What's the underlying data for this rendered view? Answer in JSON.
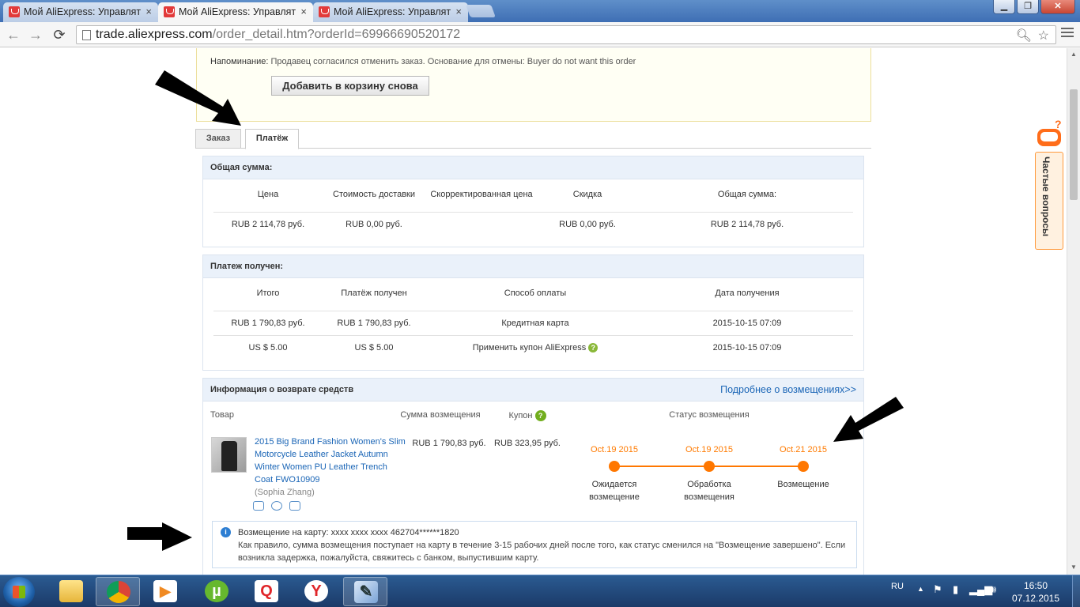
{
  "browser": {
    "tabs": [
      {
        "title": "Мой AliExpress: Управлят",
        "close": "×"
      },
      {
        "title": "Мой AliExpress: Управлят",
        "close": "×"
      },
      {
        "title": "Мой AliExpress: Управлят",
        "close": "×"
      }
    ],
    "window_buttons": {
      "minimize": "▁",
      "maximize": "❐",
      "close": "✕"
    },
    "address": {
      "host": "trade.aliexpress.com",
      "path": "/order_detail.htm?orderId=69966690520172"
    },
    "nav": {
      "back": "←",
      "forward": "→",
      "reload": "⟳"
    }
  },
  "notice": {
    "label": "Напоминание:",
    "text": "Продавец согласился отменить заказ. Основание для отмены: Buyer do not want this order",
    "button": "Добавить в корзину снова"
  },
  "tabs": [
    {
      "label": "Заказ"
    },
    {
      "label": "Платёж"
    }
  ],
  "total_panel": {
    "title": "Общая сумма:",
    "headers": [
      "Цена",
      "Стоимость доставки",
      "Скорректированная цена",
      "Скидка",
      "Общая сумма:"
    ],
    "row": [
      "RUB 2 114,78 руб.",
      "RUB 0,00 руб.",
      "",
      "RUB 0,00 руб.",
      "RUB 2 114,78 руб."
    ]
  },
  "payment_panel": {
    "title": "Платеж получен:",
    "headers": [
      "Итого",
      "Платёж получен",
      "Способ оплаты",
      "Дата получения"
    ],
    "rows": [
      [
        "RUB 1 790,83 руб.",
        "RUB 1 790,83 руб.",
        "Кредитная карта",
        "2015-10-15 07:09"
      ],
      [
        "US $ 5.00",
        "US $ 5.00",
        "Применить купон AliExpress",
        "2015-10-15 07:09"
      ]
    ]
  },
  "refund_panel": {
    "title": "Информация о возврате средств",
    "more_link": "Подробнее о возмещениях>>",
    "headers": {
      "product": "Товар",
      "amount": "Сумма возмещения",
      "coupon": "Купон",
      "status": "Статус возмещения"
    },
    "item": {
      "title": "2015 Big Brand Fashion Women's Slim Motorcycle Leather Jacket Autumn Winter Women PU Leather Trench Coat FWO10909",
      "seller": "(Sophia Zhang)",
      "amount": "RUB 1 790,83 руб.",
      "coupon": "RUB 323,95 руб."
    },
    "timeline": [
      {
        "date": "Oct.19 2015",
        "label": "Ожидается возмещение"
      },
      {
        "date": "Oct.19 2015",
        "label": "Обработка возмещения"
      },
      {
        "date": "Oct.21 2015",
        "label": "Возмещение"
      }
    ],
    "info": {
      "line1": "Возмещение на карту: xxxx xxxx xxxx 462704******1820",
      "line2": "Как правило, сумма возмещения поступает на карту в течение 3-15 рабочих дней после того, как статус сменился на \"Возмещение завершено\". Если возникла задержка, пожалуйста, свяжитесь с банком, выпустившим карту."
    }
  },
  "faq": {
    "label": "Частые вопросы"
  },
  "taskbar": {
    "lang": "RU",
    "time": "16:50",
    "date": "07.12.2015",
    "apps": [
      "explorer",
      "chrome",
      "media-player",
      "utorrent",
      "search",
      "yandex",
      "paint"
    ]
  },
  "colors": {
    "accent_orange": "#ff7700",
    "link_blue": "#1a65b6",
    "panel_head": "#eaf1fa"
  }
}
